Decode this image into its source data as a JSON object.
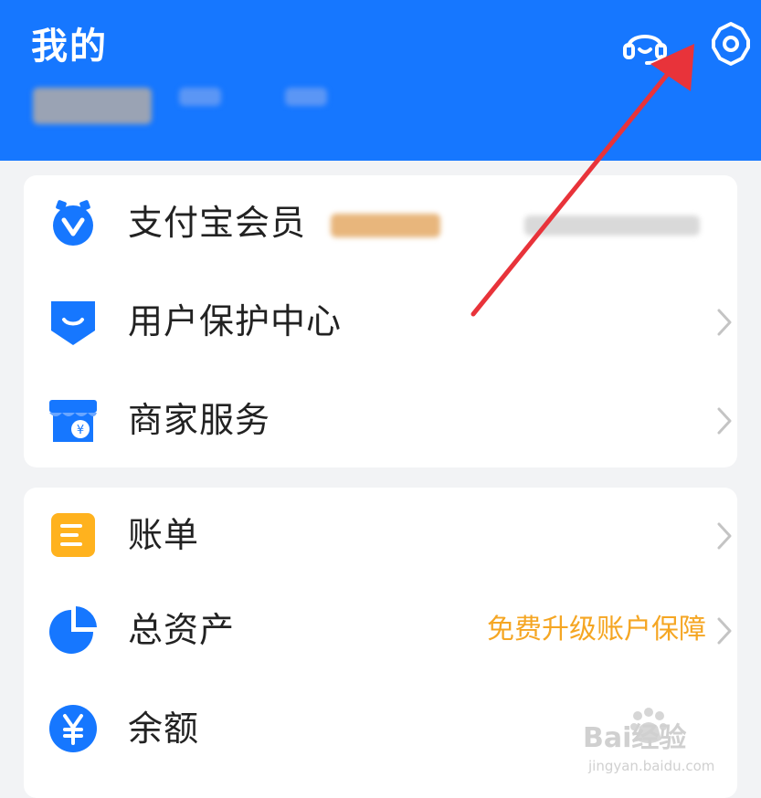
{
  "header": {
    "title": "我的",
    "icons": [
      "headset-icon",
      "settings-gear-icon"
    ],
    "background": "#1677ff"
  },
  "card1": {
    "items": [
      {
        "label": "支付宝会员",
        "icon": "member-badge-icon"
      },
      {
        "label": "用户保护中心",
        "icon": "shield-icon"
      },
      {
        "label": "商家服务",
        "icon": "store-icon"
      }
    ]
  },
  "card2": {
    "items": [
      {
        "label": "账单",
        "icon": "bill-icon"
      },
      {
        "label": "总资产",
        "icon": "pie-chart-icon",
        "note": "免费升级账户保障"
      },
      {
        "label": "余额",
        "icon": "yuan-coin-icon"
      }
    ]
  },
  "watermark": {
    "text": "Bai经验",
    "url_text": "jingyan.baidu.com"
  },
  "colors": {
    "accent": "#1677ff",
    "note": "#f5a623",
    "arrow": "#e8333a"
  }
}
